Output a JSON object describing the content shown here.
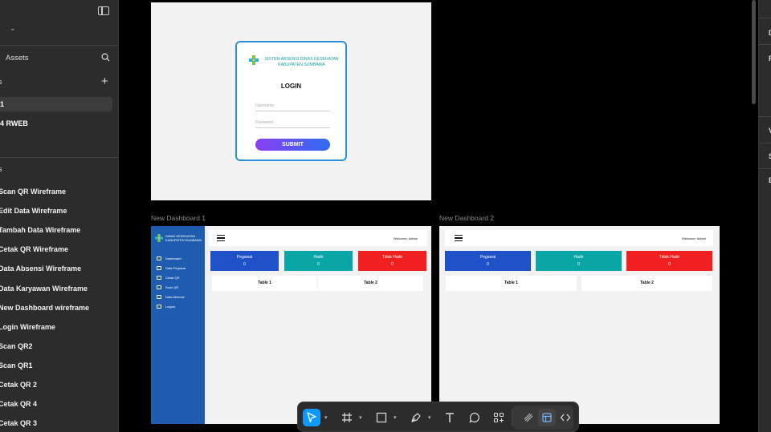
{
  "left_panel": {
    "file_name": "l",
    "assets_tab": "Assets",
    "pages_header": "s",
    "pages": [
      {
        "label": "1",
        "active": true
      },
      {
        "label": "4 RWEB",
        "active": false
      }
    ],
    "layers_header": "s",
    "layers": [
      "Scan QR Wireframe",
      "Edit Data Wireframe",
      "Tambah Data Wireframe",
      "Cetak QR Wireframe",
      "Data Absensi Wireframe",
      "Data Karyawan Wireframe",
      "New Dashboard wireframe",
      "Login Wireframe",
      "Scan QR2",
      "Scan QR1",
      "Cetak QR 2",
      "Cetak QR 4",
      "Cetak QR 3"
    ]
  },
  "right_panel": {
    "letters": [
      "D",
      "P",
      "V",
      "S",
      "E"
    ]
  },
  "login_frame": {
    "org_name": "SISTEM ABSENSI DINAS KESEHATAN KABUPATEN SUMBAWA",
    "title": "LOGIN",
    "username_placeholder": "Username",
    "password_placeholder": "Password",
    "submit_label": "SUBMIT"
  },
  "dashboard1": {
    "frame_label": "New Dashboard 1",
    "org_name": "DINAS KESEHATAN KABUPATEN SUMBAWA",
    "menu": [
      "Dashboard",
      "Data Pegawai",
      "Cetak QR",
      "Scan QR",
      "Data Absensi",
      "Logout"
    ],
    "welcome": "Welcome, Admin",
    "stats": [
      {
        "label": "Pegawai",
        "value": "0",
        "color": "#1f52c8"
      },
      {
        "label": "Hadir",
        "value": "0",
        "color": "#0aa6a6"
      },
      {
        "label": "Tidak Hadir",
        "value": "0",
        "color": "#f02020"
      }
    ],
    "tables": [
      "Table 1",
      "Table 2"
    ]
  },
  "dashboard2": {
    "frame_label": "New Dashboard 2",
    "welcome": "Welcome, Admin",
    "stats": [
      {
        "label": "Pegawai",
        "value": "0",
        "color": "#1f52c8"
      },
      {
        "label": "Hadir",
        "value": "0",
        "color": "#0aa6a6"
      },
      {
        "label": "Tidak Hadir",
        "value": "0",
        "color": "#f02020"
      }
    ],
    "tables": [
      "Table 1",
      "Table 2"
    ]
  },
  "toolbar": {
    "tools": [
      "move-tool",
      "frame-tool",
      "shape-tool",
      "pen-tool",
      "text-tool",
      "comment-tool",
      "actions-tool",
      "draw-mode",
      "design-mode",
      "dev-mode"
    ],
    "active_tool": "move-tool",
    "accent": "#0d99ff"
  }
}
